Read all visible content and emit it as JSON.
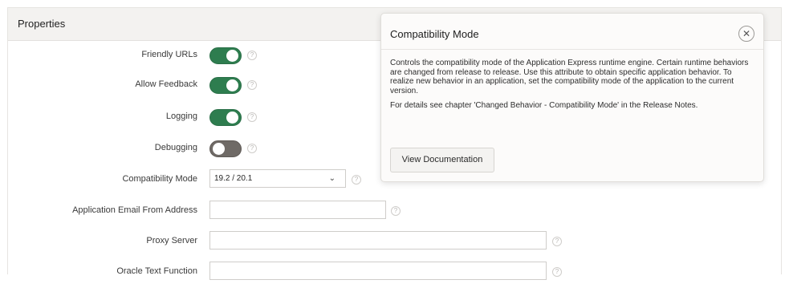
{
  "panel": {
    "title": "Properties"
  },
  "fields": {
    "friendly_urls": {
      "label": "Friendly URLs",
      "value": "on"
    },
    "allow_feedback": {
      "label": "Allow Feedback",
      "value": "on"
    },
    "logging": {
      "label": "Logging",
      "value": "on"
    },
    "debugging": {
      "label": "Debugging",
      "value": "off"
    },
    "compatibility_mode": {
      "label": "Compatibility Mode",
      "value": "19.2 / 20.1"
    },
    "email_from": {
      "label": "Application Email From Address",
      "value": ""
    },
    "proxy_server": {
      "label": "Proxy Server",
      "value": ""
    },
    "oracle_text_function": {
      "label": "Oracle Text Function",
      "value": ""
    }
  },
  "help_glyph": "?",
  "popup": {
    "title": "Compatibility Mode",
    "close_glyph": "✕",
    "paragraph1": "Controls the compatibility mode of the Application Express runtime engine. Certain runtime behaviors are changed from release to release. Use this attribute to obtain specific application behavior. To realize new behavior in an application, set the compatibility mode of the application to the current version.",
    "paragraph2": "For details see chapter 'Changed Behavior - Compatibility Mode' in the Release Notes.",
    "button": "View Documentation"
  },
  "colors": {
    "toggle_on": "#2e7d4f",
    "toggle_off": "#6f6a66",
    "header_bg": "#f3f2f0"
  }
}
